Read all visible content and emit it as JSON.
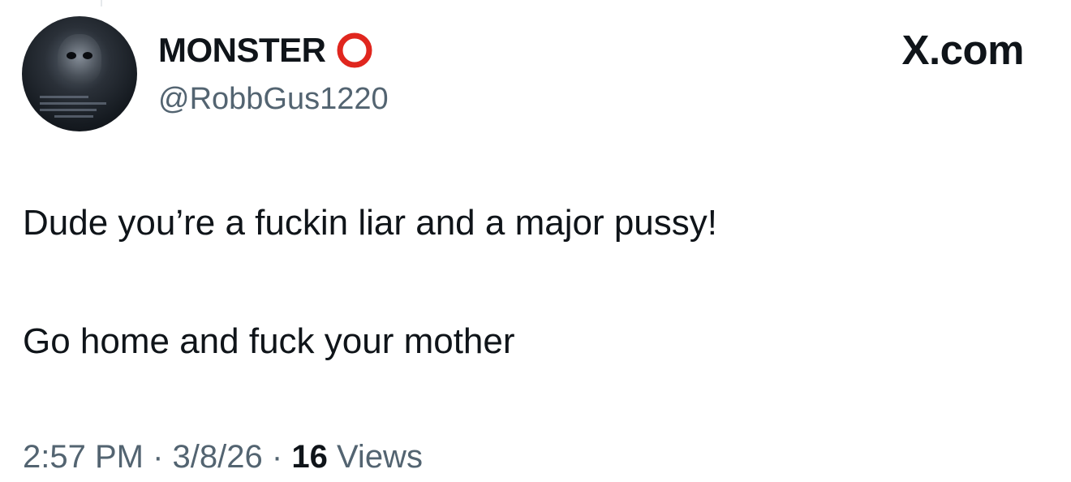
{
  "author": {
    "display_name": "MONSTER",
    "badge_icon": "red-circle-icon",
    "badge_color": "#e0261e",
    "handle": "@RobbGus1220"
  },
  "brand": {
    "label": "X.com"
  },
  "tweet": {
    "lines": [
      "Dude you’re a fuckin liar and a major pussy!",
      "Go home and fuck your mother"
    ]
  },
  "meta": {
    "time": "2:57 PM",
    "separator": "·",
    "date": "3/8/26",
    "views_count": "16",
    "views_label": "Views"
  },
  "colors": {
    "text_primary": "#0f1419",
    "text_secondary": "#536471",
    "background": "#ffffff"
  }
}
